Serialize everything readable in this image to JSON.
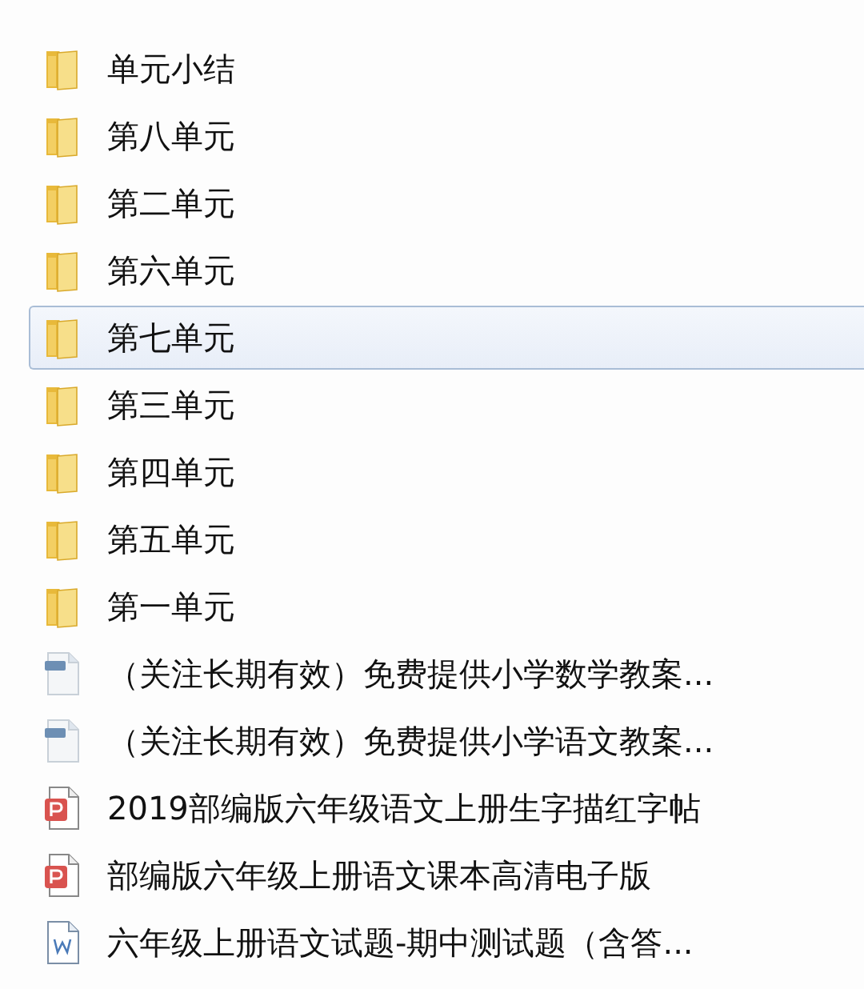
{
  "files": [
    {
      "name": "单元小结",
      "kind": "folder",
      "selected": false
    },
    {
      "name": "第八单元",
      "kind": "folder",
      "selected": false
    },
    {
      "name": "第二单元",
      "kind": "folder",
      "selected": false
    },
    {
      "name": "第六单元",
      "kind": "folder",
      "selected": false
    },
    {
      "name": "第七单元",
      "kind": "folder",
      "selected": true
    },
    {
      "name": "第三单元",
      "kind": "folder",
      "selected": false
    },
    {
      "name": "第四单元",
      "kind": "folder",
      "selected": false
    },
    {
      "name": "第五单元",
      "kind": "folder",
      "selected": false
    },
    {
      "name": "第一单元",
      "kind": "folder",
      "selected": false
    },
    {
      "name": "（关注长期有效）免费提供小学数学教案...",
      "kind": "file",
      "selected": false
    },
    {
      "name": "（关注长期有效）免费提供小学语文教案...",
      "kind": "file",
      "selected": false
    },
    {
      "name": "2019部编版六年级语文上册生字描红字帖",
      "kind": "pdf",
      "selected": false
    },
    {
      "name": "部编版六年级上册语文课本高清电子版",
      "kind": "pdf",
      "selected": false
    },
    {
      "name": "六年级上册语文试题-期中测试题（含答...",
      "kind": "word",
      "selected": false
    }
  ]
}
